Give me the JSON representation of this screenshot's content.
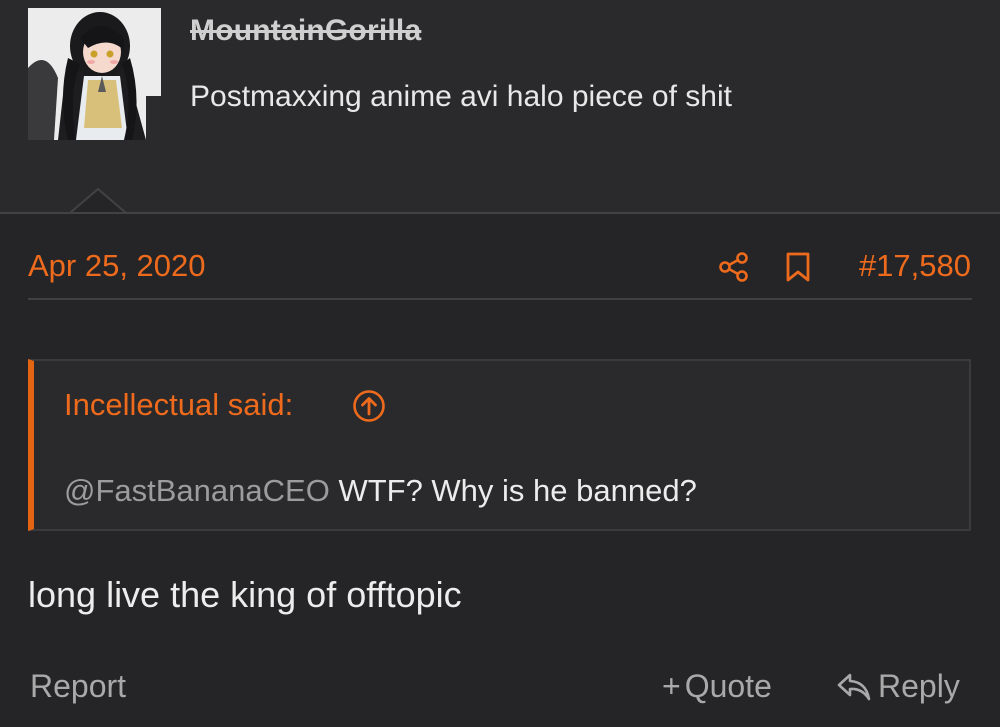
{
  "user": {
    "name": "MountainGorilla",
    "title": "Postmaxxing anime avi halo piece of shit",
    "avatar_icon": "anime-avatar-image"
  },
  "post": {
    "date": "Apr 25, 2020",
    "number": "#17,580",
    "share_icon": "share-icon",
    "bookmark_icon": "bookmark-icon",
    "quote": {
      "author": "Incellectual said:",
      "mention": "@FastBananaCEO",
      "text": " WTF? Why is he banned?"
    },
    "message": "long live the king of offtopic"
  },
  "actions": {
    "report": "Report",
    "quote_plus": "+",
    "quote": "Quote",
    "reply": "Reply"
  },
  "colors": {
    "background": "#252527",
    "accent": "#ee6a1c",
    "muted": "#a9a9a9"
  }
}
